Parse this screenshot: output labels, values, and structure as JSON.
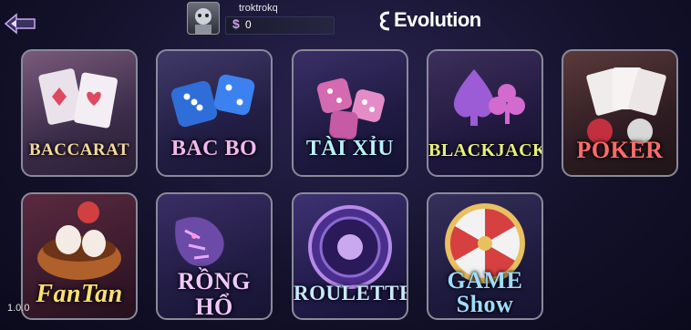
{
  "header": {
    "back_icon": "back-arrow-icon",
    "username": "troktrokq",
    "currency_symbol": "$",
    "balance": "0",
    "provider": "Evolution"
  },
  "games": [
    {
      "label": "BACCARAT",
      "color": "#f4d9a0"
    },
    {
      "label": "BAC BO",
      "color": "#f2b7f0"
    },
    {
      "label": "TÀI XỈU",
      "color": "#b9f2ff"
    },
    {
      "label": "BLACKJACK",
      "color": "#e8f07a"
    },
    {
      "label": "POKER",
      "color": "#ff6a6a"
    },
    {
      "label": "FanTan",
      "color": "#ffe070"
    },
    {
      "label": "RỒNG HỔ",
      "color": "#f0c8ff"
    },
    {
      "label": "ROULETTE",
      "color": "#c9e8ff"
    },
    {
      "label": "GAME Show",
      "color": "#9fdcff"
    }
  ],
  "footer": {
    "version": "1.0.0"
  }
}
